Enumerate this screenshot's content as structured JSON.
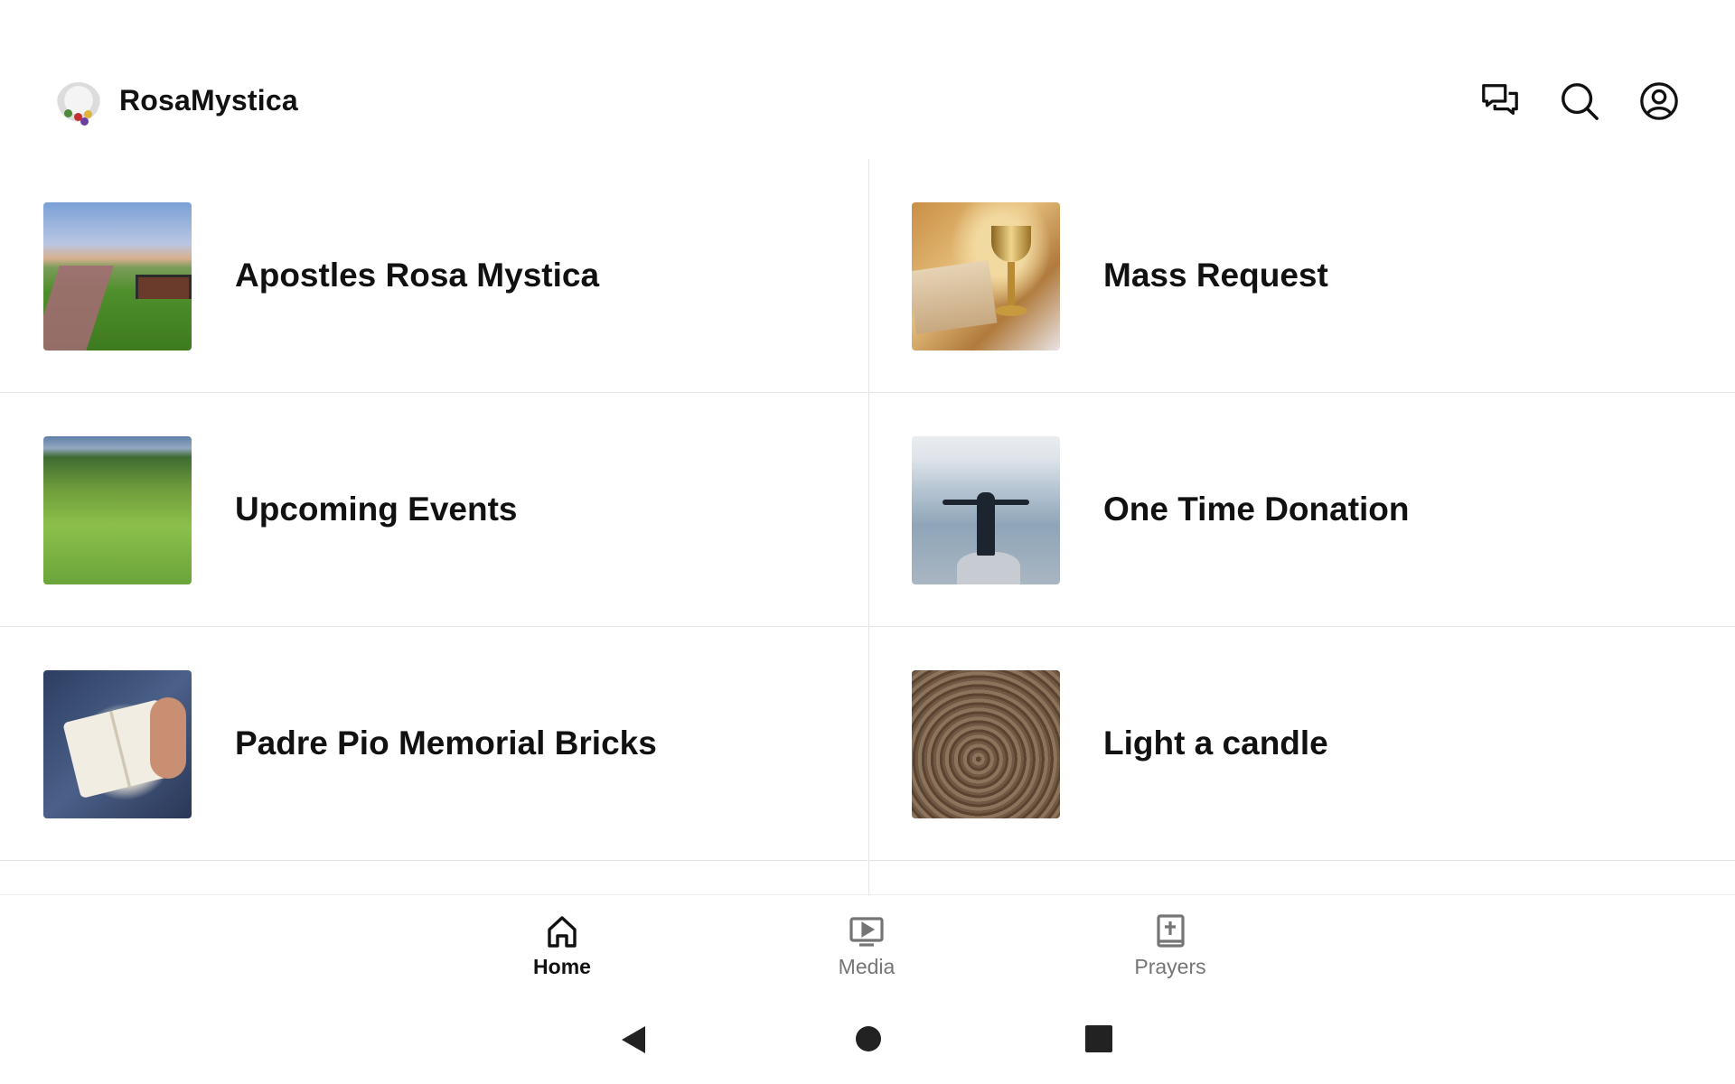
{
  "header": {
    "app_title": "RosaMystica",
    "icons": [
      "chat-icon",
      "search-icon",
      "account-icon"
    ]
  },
  "tiles": [
    {
      "label": "Apostles Rosa Mystica",
      "image": "park-bench-flags"
    },
    {
      "label": "Mass Request",
      "image": "chalice-and-bible"
    },
    {
      "label": "Upcoming Events",
      "image": "green-field-aerial"
    },
    {
      "label": "One Time Donation",
      "image": "person-on-cliff"
    },
    {
      "label": "Padre Pio Memorial Bricks",
      "image": "open-bible-in-hand"
    },
    {
      "label": "Light a candle",
      "image": "wood-rings"
    }
  ],
  "bottom_nav": {
    "items": [
      {
        "label": "Home",
        "icon": "home-icon",
        "active": true
      },
      {
        "label": "Media",
        "icon": "media-icon",
        "active": false
      },
      {
        "label": "Prayers",
        "icon": "prayer-book-icon",
        "active": false
      }
    ]
  },
  "system_nav": [
    "back-button",
    "home-button",
    "recents-button"
  ],
  "colors": {
    "text": "#111111",
    "inactive": "#757575",
    "divider": "#e3e3e3",
    "background": "#ffffff"
  }
}
